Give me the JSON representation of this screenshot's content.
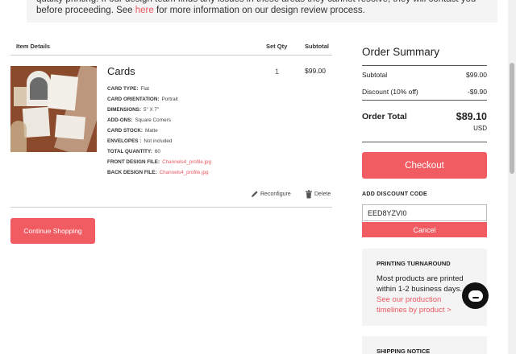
{
  "notice": {
    "text_before": "quality printing. If our design team finds any issues in these areas they cannot resolve, they will contact you before proceeding. See ",
    "link": "here",
    "text_after": " for more information on our design review process."
  },
  "cart": {
    "headers": {
      "item": "Item Details",
      "qty": "Set Qty",
      "subtotal": "Subtotal"
    },
    "item": {
      "name": "Cards",
      "details": [
        {
          "label": "Card Type:",
          "value": "Flat"
        },
        {
          "label": "Card Orientation:",
          "value": "Portrait"
        },
        {
          "label": "Dimensions:",
          "value": "5\" X 7\""
        },
        {
          "label": "Add-Ons:",
          "value": "Square Corners"
        },
        {
          "label": "Card Stock:",
          "value": "Matte"
        },
        {
          "label": "Envelopes :",
          "value": "Not included"
        },
        {
          "label": "Total Quantity:",
          "value": "60"
        },
        {
          "label": "Front Design File:",
          "value": "Channels4_profile.jpg"
        },
        {
          "label": "Back Design File:",
          "value": "Channels4_profile.jpg"
        }
      ],
      "qty": "1",
      "subtotal": "$99.00",
      "reconfigure": "Reconfigure",
      "delete": "Delete"
    },
    "continue_shopping": "Continue Shopping"
  },
  "summary": {
    "title": "Order Summary",
    "subtotal_label": "Subtotal",
    "subtotal_value": "$99.00",
    "discount_label": "Discount (10% off)",
    "discount_value": "-$9.90",
    "total_label": "Order Total",
    "total_value": "$89.10",
    "currency": "USD",
    "checkout": "Checkout",
    "discount_code_label": "ADD DISCOUNT CODE",
    "discount_code_value": "EED8YZVI0",
    "cancel": "Cancel"
  },
  "turnaround": {
    "title": "PRINTING TURNAROUND",
    "text": "Most products are printed within 1-2 business days.",
    "link": "See our production timelines by product >"
  },
  "shipping": {
    "title": "SHIPPING NOTICE"
  },
  "colors": {
    "accent": "#f15c63",
    "link": "#e8575f",
    "panel": "#f4f4f4"
  }
}
